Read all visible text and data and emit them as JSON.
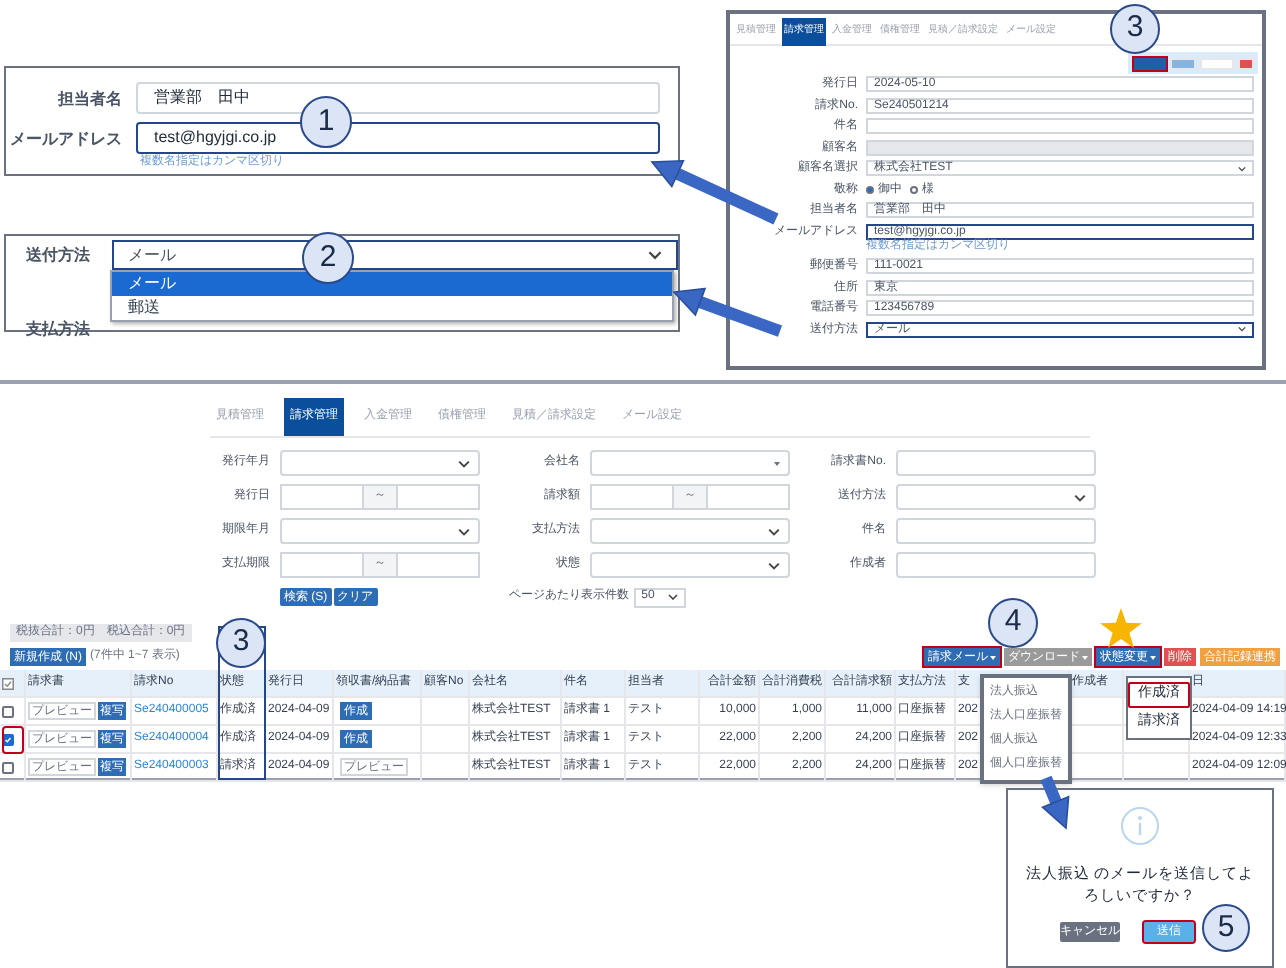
{
  "contact_panel": {
    "fields": [
      {
        "label": "担当者名",
        "value": "営業部　田中",
        "focused": false
      },
      {
        "label": "メールアドレス",
        "value": "test@hgyjgi.co.jp",
        "focused": true,
        "hint": "複数名指定はカンマ区切り"
      }
    ]
  },
  "delivery_panel": {
    "label": "送付方法",
    "value": "メール",
    "options": [
      {
        "label": "メール",
        "selected": true
      },
      {
        "label": "郵送",
        "selected": false
      }
    ],
    "next_label": "支払方法"
  },
  "form_panel": {
    "tabs": [
      {
        "label": "見積管理",
        "selected": false
      },
      {
        "label": "請求管理",
        "selected": true
      },
      {
        "label": "入金管理",
        "selected": false
      },
      {
        "label": "債権管理",
        "selected": false
      },
      {
        "label": "見積／請求設定",
        "selected": false
      },
      {
        "label": "メール設定",
        "selected": false
      }
    ],
    "toolbar": [
      {
        "color": "#1f5fa8",
        "highlighted": true
      },
      {
        "color": "#86b4e0",
        "highlighted": false
      },
      {
        "color": "#ffffff",
        "highlighted": false
      },
      {
        "color": "#e05252",
        "highlighted": false
      }
    ],
    "fields": [
      {
        "label": "発行日",
        "kind": "text",
        "value": "2024-05-10",
        "focused": false
      },
      {
        "label": "請求No.",
        "kind": "text",
        "value": "Se240501214",
        "focused": false
      },
      {
        "label": "件名",
        "kind": "text",
        "focused": false
      },
      {
        "label": "顧客名",
        "kind": "disabled",
        "focused": false
      },
      {
        "label": "顧客名選択",
        "kind": "select",
        "value": "株式会社TEST",
        "focused": false
      },
      {
        "label": "敬称",
        "kind": "radio",
        "focused": false,
        "options": [
          {
            "label": "御中",
            "selected": true
          },
          {
            "label": "様",
            "selected": false
          }
        ]
      },
      {
        "label": "担当者名",
        "kind": "text",
        "value": "営業部　田中",
        "focused": false
      },
      {
        "label": "メールアドレス",
        "kind": "text",
        "value": "test@hgyjgi.co.jp",
        "focused": true,
        "hint": "複数名指定はカンマ区切り"
      },
      {
        "label": "郵便番号",
        "kind": "text",
        "value": "111-0021",
        "focused": false
      },
      {
        "label": "住所",
        "kind": "text",
        "value": "東京",
        "focused": false
      },
      {
        "label": "電話番号",
        "kind": "text",
        "value": "123456789",
        "focused": false
      },
      {
        "label": "送付方法",
        "kind": "select",
        "value": "メール",
        "focused": true
      }
    ]
  },
  "invoice_list": {
    "tabs": [
      {
        "label": "見積管理",
        "selected": false
      },
      {
        "label": "請求管理",
        "selected": true
      },
      {
        "label": "入金管理",
        "selected": false
      },
      {
        "label": "債権管理",
        "selected": false
      },
      {
        "label": "見積／請求設定",
        "selected": false
      },
      {
        "label": "メール設定",
        "selected": false
      }
    ],
    "filters": [
      {
        "label": "発行年月",
        "kind": "select"
      },
      {
        "label": "会社名",
        "kind": "combo"
      },
      {
        "label": "請求書No.",
        "kind": "text"
      },
      {
        "label": "発行日",
        "kind": "range",
        "separator": "～"
      },
      {
        "label": "請求額",
        "kind": "range",
        "separator": "～"
      },
      {
        "label": "送付方法",
        "kind": "select"
      },
      {
        "label": "期限年月",
        "kind": "select"
      },
      {
        "label": "支払方法",
        "kind": "select"
      },
      {
        "label": "件名",
        "kind": "text"
      },
      {
        "label": "支払期限",
        "kind": "range",
        "separator": "～"
      },
      {
        "label": "状態",
        "kind": "select"
      },
      {
        "label": "作成者",
        "kind": "text"
      }
    ],
    "search_button": "検索 (S)",
    "clear_button": "クリア",
    "page_size": {
      "label": "ページあたり表示件数",
      "value": "50"
    },
    "totals": [
      "税抜合計：0円",
      "税込合計：0円"
    ],
    "new_button": "新規作成 (N)",
    "count": "(7件中 1~7 表示)",
    "toolbar": [
      {
        "label": "請求メール",
        "color": "#2e6db3",
        "menu": true,
        "highlighted": true,
        "starred": false
      },
      {
        "label": "ダウンロード",
        "color": "#9a9a9a",
        "menu": true,
        "highlighted": false,
        "starred": false
      },
      {
        "label": "状態変更",
        "color": "#2e6db3",
        "menu": true,
        "highlighted": true,
        "starred": true
      },
      {
        "label": "削除",
        "color": "#e05252",
        "menu": false,
        "highlighted": false,
        "starred": false
      },
      {
        "label": "合計記録連携",
        "color": "#f0a040",
        "menu": false,
        "highlighted": false,
        "starred": false
      }
    ],
    "columns": [
      {
        "kind": "check",
        "highlighted": false
      },
      {
        "label": "請求書",
        "kind": "doc_buttons",
        "highlighted": false
      },
      {
        "label": "請求No",
        "kind": "link",
        "highlighted": false
      },
      {
        "label": "状態",
        "kind": "text",
        "highlighted": true
      },
      {
        "label": "発行日",
        "kind": "text",
        "highlighted": false
      },
      {
        "label": "領収書/納品書",
        "kind": "receipt",
        "highlighted": false
      },
      {
        "label": "顧客No",
        "kind": "text",
        "highlighted": false
      },
      {
        "label": "会社名",
        "kind": "text",
        "highlighted": false
      },
      {
        "label": "件名",
        "kind": "text",
        "highlighted": false
      },
      {
        "label": "担当者",
        "kind": "text",
        "highlighted": false
      },
      {
        "label": "合計金額",
        "kind": "num",
        "highlighted": false
      },
      {
        "label": "合計消費税",
        "kind": "num",
        "highlighted": false
      },
      {
        "label": "合計請求額",
        "kind": "num",
        "highlighted": false
      },
      {
        "label": "支払方法",
        "kind": "text",
        "highlighted": false
      },
      {
        "label": "支",
        "kind": "text",
        "highlighted": false
      },
      {
        "label": "作成者",
        "kind": "text",
        "highlighted": false
      },
      {
        "kind": "blank",
        "highlighted": false
      },
      {
        "label": "日",
        "kind": "text",
        "highlighted": false
      }
    ],
    "rows": [
      {
        "checked": false,
        "highlighted": false,
        "cells": [
          {},
          {
            "preview": "プレビュー",
            "copy": "複写"
          },
          "Se240400005",
          "作成済",
          "2024-04-09",
          {
            "kind": "button",
            "label": "作成"
          },
          null,
          "株式会社TEST",
          "請求書 1",
          "テスト",
          "10,000",
          "1,000",
          "11,000",
          "口座振替",
          "202",
          null,
          {},
          "2024-04-09 14:19"
        ]
      },
      {
        "checked": true,
        "highlighted": true,
        "cells": [
          {},
          {
            "preview": "プレビュー",
            "copy": "複写"
          },
          "Se240400004",
          "作成済",
          "2024-04-09",
          {
            "kind": "button",
            "label": "作成"
          },
          null,
          "株式会社TEST",
          "請求書 1",
          "テスト",
          "22,000",
          "2,200",
          "24,200",
          "口座振替",
          "202",
          null,
          {},
          "2024-04-09 12:33"
        ]
      },
      {
        "checked": false,
        "highlighted": false,
        "cells": [
          {},
          {
            "preview": "プレビュー",
            "copy": "複写"
          },
          "Se240400003",
          "請求済",
          "2024-04-09",
          {
            "kind": "outline",
            "label": "プレビュー"
          },
          null,
          "株式会社TEST",
          "請求書 1",
          "テスト",
          "22,000",
          "2,200",
          "24,200",
          "口座振替",
          "202",
          null,
          {},
          "2024-04-09 12:09"
        ]
      }
    ],
    "mail_menu": [
      {
        "label": "法人振込",
        "highlighted": false
      },
      {
        "label": "法人口座振替",
        "highlighted": false
      },
      {
        "label": "個人振込",
        "highlighted": false
      },
      {
        "label": "個人口座振替",
        "highlighted": false
      }
    ],
    "state_menu": [
      {
        "label": "作成済",
        "highlighted": true
      },
      {
        "label": "請求済",
        "highlighted": false
      }
    ]
  },
  "dialog": {
    "message": "法人振込 のメールを送信してよろしいですか？",
    "buttons": [
      {
        "label": "キャンセル",
        "kind": "cancel",
        "highlighted": false
      },
      {
        "label": "送信",
        "kind": "confirm",
        "highlighted": true
      }
    ]
  },
  "callouts": [
    {
      "number": "1"
    },
    {
      "number": "2"
    },
    {
      "number": "3"
    },
    {
      "number": "3"
    },
    {
      "number": "4"
    },
    {
      "number": "5"
    }
  ]
}
